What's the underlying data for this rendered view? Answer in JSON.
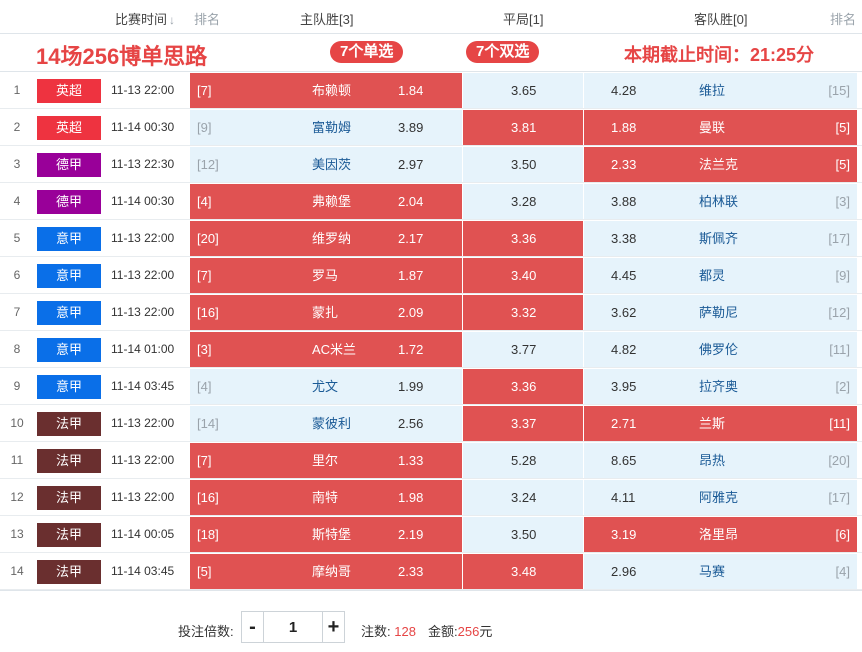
{
  "header": {
    "match_time": "比赛时间",
    "rank_left": "排名",
    "home_win": "主队胜[3]",
    "draw": "平局[1]",
    "away_win": "客队胜[0]",
    "rank_right": "排名"
  },
  "banner": {
    "title": "14场256博单思路",
    "singles": "7个单选",
    "doubles": "7个双选",
    "deadline": "本期截止时间：21:25分"
  },
  "colors": {
    "premier": "#ee3340",
    "bundesliga": "#990099",
    "seriea": "#0a6fe8",
    "ligue1": "#6a2f2f",
    "selected": "#e05252",
    "unselected": "#e6f3fb"
  },
  "matches": [
    {
      "idx": "1",
      "league": "英超",
      "color": "#ee3340",
      "time": "11-13 22:00",
      "home_rank": "[7]",
      "home": "布赖顿",
      "home_odds": "1.84",
      "draw_odds": "3.65",
      "away_odds": "4.28",
      "away": "维拉",
      "away_rank": "[15]",
      "home_sel": true,
      "draw_sel": false,
      "away_sel": false
    },
    {
      "idx": "2",
      "league": "英超",
      "color": "#ee3340",
      "time": "11-14 00:30",
      "home_rank": "[9]",
      "home": "富勒姆",
      "home_odds": "3.89",
      "draw_odds": "3.81",
      "away_odds": "1.88",
      "away": "曼联",
      "away_rank": "[5]",
      "home_sel": false,
      "draw_sel": true,
      "away_sel": true
    },
    {
      "idx": "3",
      "league": "德甲",
      "color": "#990099",
      "time": "11-13 22:30",
      "home_rank": "[12]",
      "home": "美因茨",
      "home_odds": "2.97",
      "draw_odds": "3.50",
      "away_odds": "2.33",
      "away": "法兰克",
      "away_rank": "[5]",
      "home_sel": false,
      "draw_sel": false,
      "away_sel": true
    },
    {
      "idx": "4",
      "league": "德甲",
      "color": "#990099",
      "time": "11-14 00:30",
      "home_rank": "[4]",
      "home": "弗赖堡",
      "home_odds": "2.04",
      "draw_odds": "3.28",
      "away_odds": "3.88",
      "away": "柏林联",
      "away_rank": "[3]",
      "home_sel": true,
      "draw_sel": false,
      "away_sel": false
    },
    {
      "idx": "5",
      "league": "意甲",
      "color": "#0a6fe8",
      "time": "11-13 22:00",
      "home_rank": "[20]",
      "home": "维罗纳",
      "home_odds": "2.17",
      "draw_odds": "3.36",
      "away_odds": "3.38",
      "away": "斯佩齐",
      "away_rank": "[17]",
      "home_sel": true,
      "draw_sel": true,
      "away_sel": false
    },
    {
      "idx": "6",
      "league": "意甲",
      "color": "#0a6fe8",
      "time": "11-13 22:00",
      "home_rank": "[7]",
      "home": "罗马",
      "home_odds": "1.87",
      "draw_odds": "3.40",
      "away_odds": "4.45",
      "away": "都灵",
      "away_rank": "[9]",
      "home_sel": true,
      "draw_sel": true,
      "away_sel": false
    },
    {
      "idx": "7",
      "league": "意甲",
      "color": "#0a6fe8",
      "time": "11-13 22:00",
      "home_rank": "[16]",
      "home": "蒙扎",
      "home_odds": "2.09",
      "draw_odds": "3.32",
      "away_odds": "3.62",
      "away": "萨勒尼",
      "away_rank": "[12]",
      "home_sel": true,
      "draw_sel": true,
      "away_sel": false
    },
    {
      "idx": "8",
      "league": "意甲",
      "color": "#0a6fe8",
      "time": "11-14 01:00",
      "home_rank": "[3]",
      "home": "AC米兰",
      "home_odds": "1.72",
      "draw_odds": "3.77",
      "away_odds": "4.82",
      "away": "佛罗伦",
      "away_rank": "[11]",
      "home_sel": true,
      "draw_sel": false,
      "away_sel": false
    },
    {
      "idx": "9",
      "league": "意甲",
      "color": "#0a6fe8",
      "time": "11-14 03:45",
      "home_rank": "[4]",
      "home": "尤文",
      "home_odds": "1.99",
      "draw_odds": "3.36",
      "away_odds": "3.95",
      "away": "拉齐奥",
      "away_rank": "[2]",
      "home_sel": false,
      "draw_sel": true,
      "away_sel": false
    },
    {
      "idx": "10",
      "league": "法甲",
      "color": "#6a2f2f",
      "time": "11-13 22:00",
      "home_rank": "[14]",
      "home": "蒙彼利",
      "home_odds": "2.56",
      "draw_odds": "3.37",
      "away_odds": "2.71",
      "away": "兰斯",
      "away_rank": "[11]",
      "home_sel": false,
      "draw_sel": true,
      "away_sel": true
    },
    {
      "idx": "11",
      "league": "法甲",
      "color": "#6a2f2f",
      "time": "11-13 22:00",
      "home_rank": "[7]",
      "home": "里尔",
      "home_odds": "1.33",
      "draw_odds": "5.28",
      "away_odds": "8.65",
      "away": "昂热",
      "away_rank": "[20]",
      "home_sel": true,
      "draw_sel": false,
      "away_sel": false
    },
    {
      "idx": "12",
      "league": "法甲",
      "color": "#6a2f2f",
      "time": "11-13 22:00",
      "home_rank": "[16]",
      "home": "南特",
      "home_odds": "1.98",
      "draw_odds": "3.24",
      "away_odds": "4.11",
      "away": "阿雅克",
      "away_rank": "[17]",
      "home_sel": true,
      "draw_sel": false,
      "away_sel": false
    },
    {
      "idx": "13",
      "league": "法甲",
      "color": "#6a2f2f",
      "time": "11-14 00:05",
      "home_rank": "[18]",
      "home": "斯特堡",
      "home_odds": "2.19",
      "draw_odds": "3.50",
      "away_odds": "3.19",
      "away": "洛里昂",
      "away_rank": "[6]",
      "home_sel": true,
      "draw_sel": false,
      "away_sel": true
    },
    {
      "idx": "14",
      "league": "法甲",
      "color": "#6a2f2f",
      "time": "11-14 03:45",
      "home_rank": "[5]",
      "home": "摩纳哥",
      "home_odds": "2.33",
      "draw_odds": "3.48",
      "away_odds": "2.96",
      "away": "马赛",
      "away_rank": "[4]",
      "home_sel": true,
      "draw_sel": true,
      "away_sel": false
    }
  ],
  "footer": {
    "multiplier_label": "投注倍数:",
    "minus": "-",
    "multiplier_value": "1",
    "plus": "+",
    "bets_label": "注数:",
    "bets_value": "128",
    "amount_label": "金额:",
    "amount_value": "256",
    "amount_unit": "元"
  }
}
